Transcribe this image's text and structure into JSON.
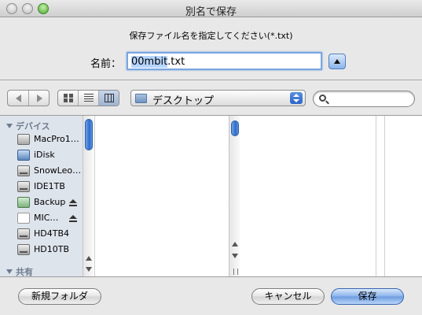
{
  "window": {
    "title": "別名で保存"
  },
  "header": {
    "prompt": "保存ファイル名を指定してください(*.txt)",
    "name_label": "名前：",
    "filename_selected": "00mbit",
    "filename_ext": ".txt"
  },
  "toolbar": {
    "back_icon": "chevron-left-icon",
    "forward_icon": "chevron-right-icon",
    "view_modes": [
      "icon-view",
      "list-view",
      "column-view"
    ],
    "active_view": "column-view",
    "location": "デスクトップ",
    "search_placeholder": ""
  },
  "sidebar": {
    "devices_header": "デバイス",
    "devices": [
      {
        "label": "MacPro1…",
        "icon": "computer-icon",
        "eject": false
      },
      {
        "label": "iDisk",
        "icon": "idisk-icon",
        "eject": false
      },
      {
        "label": "SnowLeo…",
        "icon": "hard-drive-icon",
        "eject": false
      },
      {
        "label": "IDE1TB",
        "icon": "hard-drive-icon",
        "eject": false
      },
      {
        "label": "Backup",
        "icon": "external-drive-icon",
        "eject": true
      },
      {
        "label": "MIC…",
        "icon": "disk-image-icon",
        "eject": true
      },
      {
        "label": "HD4TB4",
        "icon": "hard-drive-icon",
        "eject": false
      },
      {
        "label": "HD10TB",
        "icon": "hard-drive-icon",
        "eject": false
      }
    ],
    "shared_header": "共有"
  },
  "footer": {
    "new_folder": "新規フォルダ",
    "cancel": "キャンセル",
    "save": "保存"
  },
  "colors": {
    "accent": "#5b8fdc",
    "sidebar_bg": "#dee4ec"
  }
}
